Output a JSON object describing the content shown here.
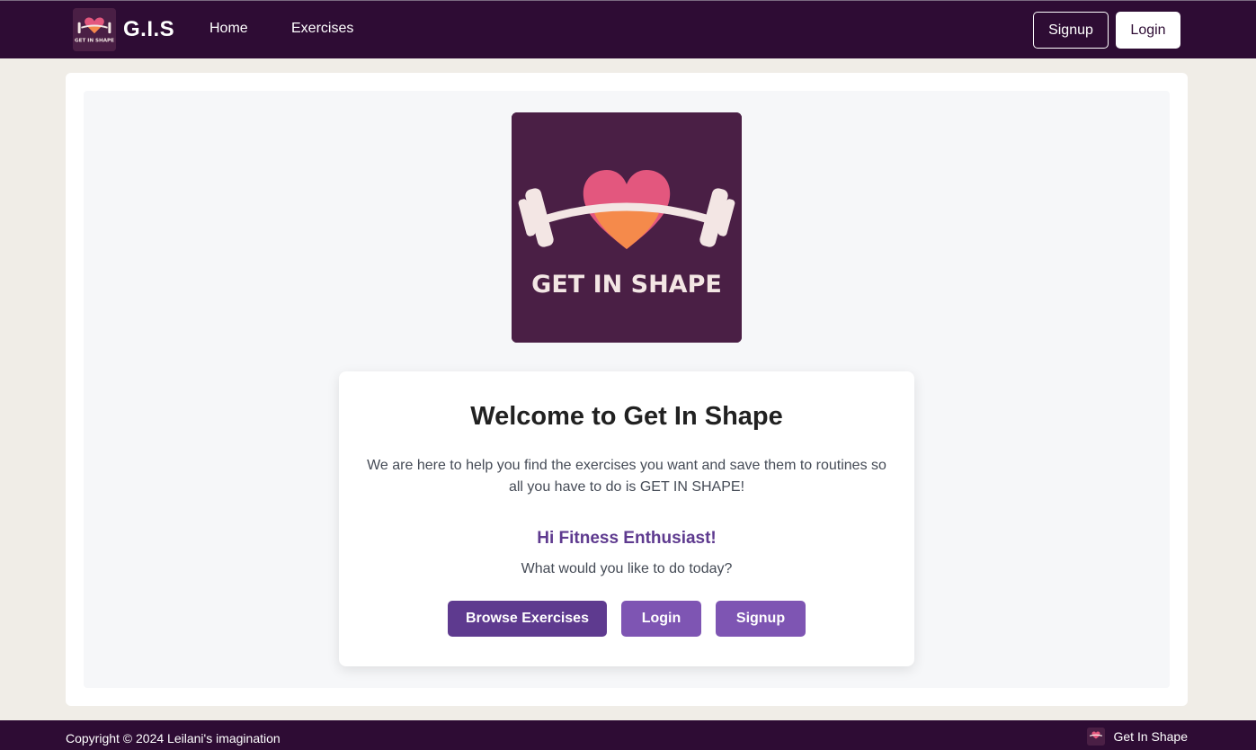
{
  "nav": {
    "brand_text": "G.I.S",
    "links": [
      "Home",
      "Exercises"
    ],
    "signup_label": "Signup",
    "login_label": "Login"
  },
  "hero": {
    "logo_text": "GET IN SHAPE",
    "title": "Welcome to Get In Shape",
    "description": "We are here to help you find the exercises you want and save them to routines so all you have to do is GET IN SHAPE!",
    "greeting": "Hi Fitness Enthusiast!",
    "question": "What would you like to do today?",
    "buttons": {
      "browse": "Browse Exercises",
      "login": "Login",
      "signup": "Signup"
    }
  },
  "footer": {
    "copyright": "Copyright © 2024 Leilani's imagination",
    "brand": "Get In Shape"
  },
  "colors": {
    "nav_bg": "#2e0c34",
    "logo_bg": "#4a1f45",
    "primary": "#5e3a8f",
    "secondary": "#7e55b3",
    "heart_top": "#e3577e",
    "heart_bottom": "#f58a4b"
  }
}
